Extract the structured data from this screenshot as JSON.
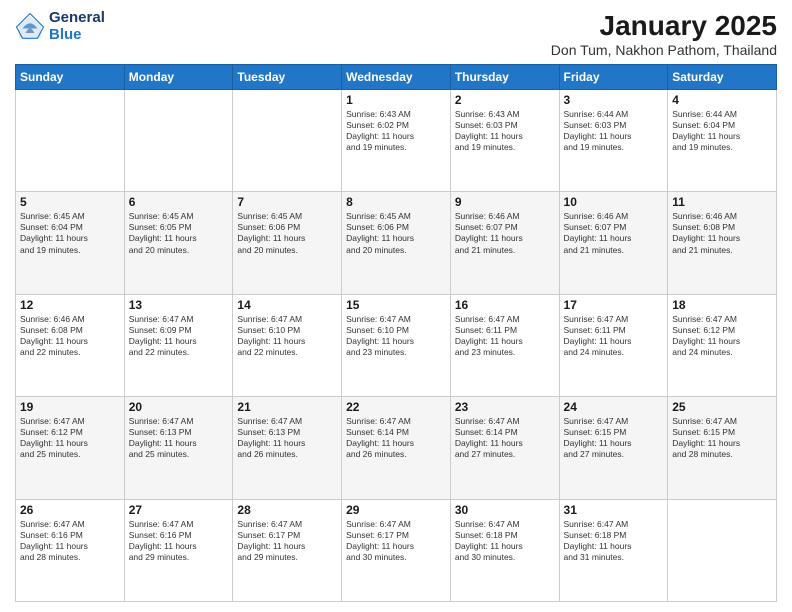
{
  "header": {
    "logo_line1": "General",
    "logo_line2": "Blue",
    "title": "January 2025",
    "subtitle": "Don Tum, Nakhon Pathom, Thailand"
  },
  "days_of_week": [
    "Sunday",
    "Monday",
    "Tuesday",
    "Wednesday",
    "Thursday",
    "Friday",
    "Saturday"
  ],
  "weeks": [
    [
      {
        "day": "",
        "info": ""
      },
      {
        "day": "",
        "info": ""
      },
      {
        "day": "",
        "info": ""
      },
      {
        "day": "1",
        "info": "Sunrise: 6:43 AM\nSunset: 6:02 PM\nDaylight: 11 hours\nand 19 minutes."
      },
      {
        "day": "2",
        "info": "Sunrise: 6:43 AM\nSunset: 6:03 PM\nDaylight: 11 hours\nand 19 minutes."
      },
      {
        "day": "3",
        "info": "Sunrise: 6:44 AM\nSunset: 6:03 PM\nDaylight: 11 hours\nand 19 minutes."
      },
      {
        "day": "4",
        "info": "Sunrise: 6:44 AM\nSunset: 6:04 PM\nDaylight: 11 hours\nand 19 minutes."
      }
    ],
    [
      {
        "day": "5",
        "info": "Sunrise: 6:45 AM\nSunset: 6:04 PM\nDaylight: 11 hours\nand 19 minutes."
      },
      {
        "day": "6",
        "info": "Sunrise: 6:45 AM\nSunset: 6:05 PM\nDaylight: 11 hours\nand 20 minutes."
      },
      {
        "day": "7",
        "info": "Sunrise: 6:45 AM\nSunset: 6:06 PM\nDaylight: 11 hours\nand 20 minutes."
      },
      {
        "day": "8",
        "info": "Sunrise: 6:45 AM\nSunset: 6:06 PM\nDaylight: 11 hours\nand 20 minutes."
      },
      {
        "day": "9",
        "info": "Sunrise: 6:46 AM\nSunset: 6:07 PM\nDaylight: 11 hours\nand 21 minutes."
      },
      {
        "day": "10",
        "info": "Sunrise: 6:46 AM\nSunset: 6:07 PM\nDaylight: 11 hours\nand 21 minutes."
      },
      {
        "day": "11",
        "info": "Sunrise: 6:46 AM\nSunset: 6:08 PM\nDaylight: 11 hours\nand 21 minutes."
      }
    ],
    [
      {
        "day": "12",
        "info": "Sunrise: 6:46 AM\nSunset: 6:08 PM\nDaylight: 11 hours\nand 22 minutes."
      },
      {
        "day": "13",
        "info": "Sunrise: 6:47 AM\nSunset: 6:09 PM\nDaylight: 11 hours\nand 22 minutes."
      },
      {
        "day": "14",
        "info": "Sunrise: 6:47 AM\nSunset: 6:10 PM\nDaylight: 11 hours\nand 22 minutes."
      },
      {
        "day": "15",
        "info": "Sunrise: 6:47 AM\nSunset: 6:10 PM\nDaylight: 11 hours\nand 23 minutes."
      },
      {
        "day": "16",
        "info": "Sunrise: 6:47 AM\nSunset: 6:11 PM\nDaylight: 11 hours\nand 23 minutes."
      },
      {
        "day": "17",
        "info": "Sunrise: 6:47 AM\nSunset: 6:11 PM\nDaylight: 11 hours\nand 24 minutes."
      },
      {
        "day": "18",
        "info": "Sunrise: 6:47 AM\nSunset: 6:12 PM\nDaylight: 11 hours\nand 24 minutes."
      }
    ],
    [
      {
        "day": "19",
        "info": "Sunrise: 6:47 AM\nSunset: 6:12 PM\nDaylight: 11 hours\nand 25 minutes."
      },
      {
        "day": "20",
        "info": "Sunrise: 6:47 AM\nSunset: 6:13 PM\nDaylight: 11 hours\nand 25 minutes."
      },
      {
        "day": "21",
        "info": "Sunrise: 6:47 AM\nSunset: 6:13 PM\nDaylight: 11 hours\nand 26 minutes."
      },
      {
        "day": "22",
        "info": "Sunrise: 6:47 AM\nSunset: 6:14 PM\nDaylight: 11 hours\nand 26 minutes."
      },
      {
        "day": "23",
        "info": "Sunrise: 6:47 AM\nSunset: 6:14 PM\nDaylight: 11 hours\nand 27 minutes."
      },
      {
        "day": "24",
        "info": "Sunrise: 6:47 AM\nSunset: 6:15 PM\nDaylight: 11 hours\nand 27 minutes."
      },
      {
        "day": "25",
        "info": "Sunrise: 6:47 AM\nSunset: 6:15 PM\nDaylight: 11 hours\nand 28 minutes."
      }
    ],
    [
      {
        "day": "26",
        "info": "Sunrise: 6:47 AM\nSunset: 6:16 PM\nDaylight: 11 hours\nand 28 minutes."
      },
      {
        "day": "27",
        "info": "Sunrise: 6:47 AM\nSunset: 6:16 PM\nDaylight: 11 hours\nand 29 minutes."
      },
      {
        "day": "28",
        "info": "Sunrise: 6:47 AM\nSunset: 6:17 PM\nDaylight: 11 hours\nand 29 minutes."
      },
      {
        "day": "29",
        "info": "Sunrise: 6:47 AM\nSunset: 6:17 PM\nDaylight: 11 hours\nand 30 minutes."
      },
      {
        "day": "30",
        "info": "Sunrise: 6:47 AM\nSunset: 6:18 PM\nDaylight: 11 hours\nand 30 minutes."
      },
      {
        "day": "31",
        "info": "Sunrise: 6:47 AM\nSunset: 6:18 PM\nDaylight: 11 hours\nand 31 minutes."
      },
      {
        "day": "",
        "info": ""
      }
    ]
  ]
}
